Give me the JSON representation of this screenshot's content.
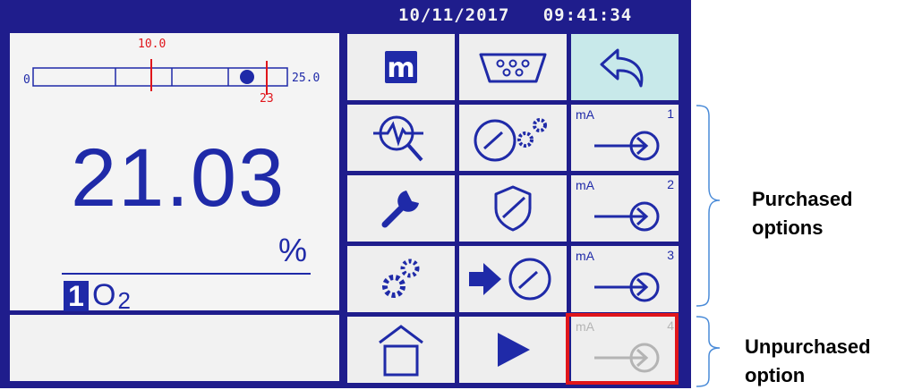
{
  "header": {
    "date": "10/11/2017",
    "time": "09:41:34"
  },
  "measurement": {
    "scale_min": "0",
    "scale_max": "25.0",
    "alarm_low": "10.0",
    "alarm_high": "23",
    "value": "21.03",
    "unit": "%",
    "channel": "1",
    "gas_main": "O",
    "gas_sub": "2"
  },
  "grid": {
    "output_label": "mA",
    "output_1_number": "1",
    "output_2_number": "2",
    "output_3_number": "3",
    "output_4_number": "4"
  },
  "annotations": {
    "purchased_line1": "Purchased",
    "purchased_line2": "options",
    "unpurchased_line1": "Unpurchased",
    "unpurchased_line2": "option"
  },
  "colors": {
    "screen_bg": "#1f1d8c",
    "accent": "#1f2aa8",
    "teal": "#c8e9ea",
    "disabled": "#b4b4b4",
    "highlight": "#e0151b"
  }
}
